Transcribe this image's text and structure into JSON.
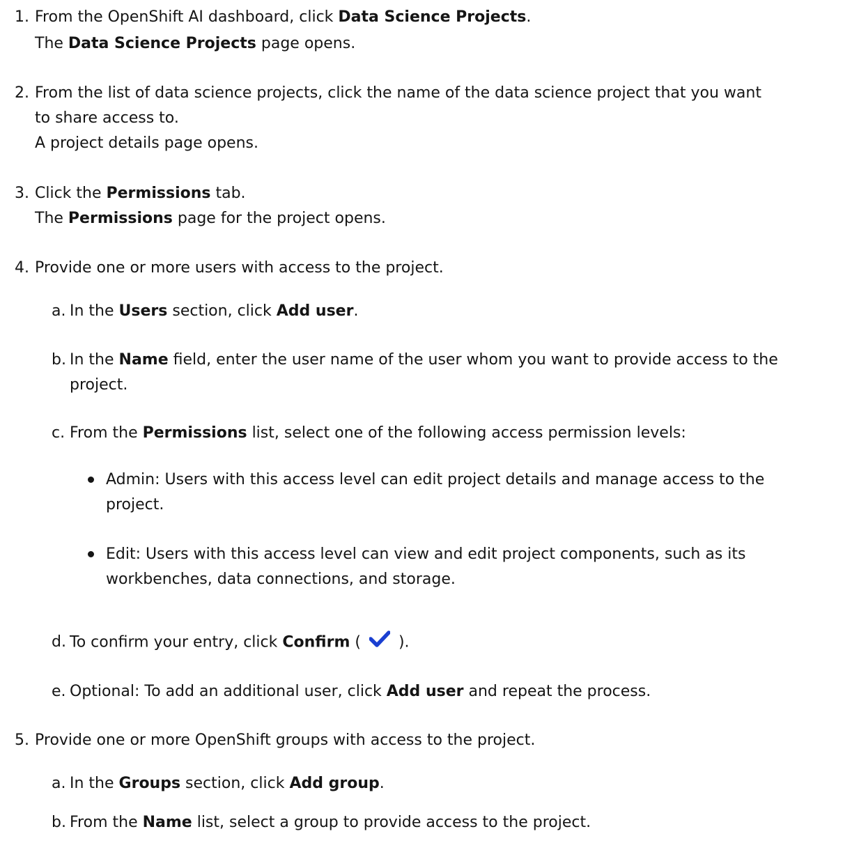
{
  "steps": [
    {
      "num": "1.",
      "parts": [
        "From the OpenShift AI dashboard, click ",
        "Data Science Projects",
        "."
      ],
      "result_parts": [
        "The ",
        "Data Science Projects",
        " page opens."
      ]
    },
    {
      "num": "2.",
      "line1": "From the list of data science projects, click the name of the data science project that you want",
      "line2": "to share access to.",
      "result": "A project details page opens."
    },
    {
      "num": "3.",
      "parts": [
        "Click the ",
        "Permissions",
        " tab."
      ],
      "result_parts": [
        "The ",
        "Permissions",
        " page for the project opens."
      ]
    },
    {
      "num": "4.",
      "text": "Provide one or more users with access to the project.",
      "substeps": {
        "a": {
          "label": "a.",
          "parts": [
            "In the ",
            "Users",
            " section, click ",
            "Add user",
            "."
          ]
        },
        "b": {
          "label": "b.",
          "parts": [
            "In the ",
            "Name",
            " field, enter the user name of the user whom you want to provide access to the"
          ],
          "line2": "project."
        },
        "c": {
          "label": "c.",
          "parts": [
            "From the ",
            "Permissions",
            " list, select one of the following access permission levels:"
          ],
          "bullets": [
            {
              "line1": "Admin: Users with this access level can edit project details and manage access to the",
              "line2": "project."
            },
            {
              "line1": "Edit: Users with this access level can view and edit project components, such as its",
              "line2": "workbenches, data connections, and storage."
            }
          ]
        },
        "d": {
          "label": "d.",
          "parts": [
            "To confirm your entry, click ",
            "Confirm",
            " (",
            ")."
          ],
          "icon": "checkmark-icon",
          "icon_color": "#1a3fd1"
        },
        "e": {
          "label": "e.",
          "parts": [
            "Optional: To add an additional user, click ",
            "Add user",
            " and repeat the process."
          ]
        }
      }
    },
    {
      "num": "5.",
      "text": "Provide one or more OpenShift groups with access to the project.",
      "substeps": {
        "a": {
          "label": "a.",
          "parts": [
            "In the ",
            "Groups",
            " section, click ",
            "Add group",
            "."
          ]
        },
        "b": {
          "label": "b.",
          "parts": [
            "From the ",
            "Name",
            " list, select a group to provide access to the project."
          ]
        }
      }
    }
  ]
}
